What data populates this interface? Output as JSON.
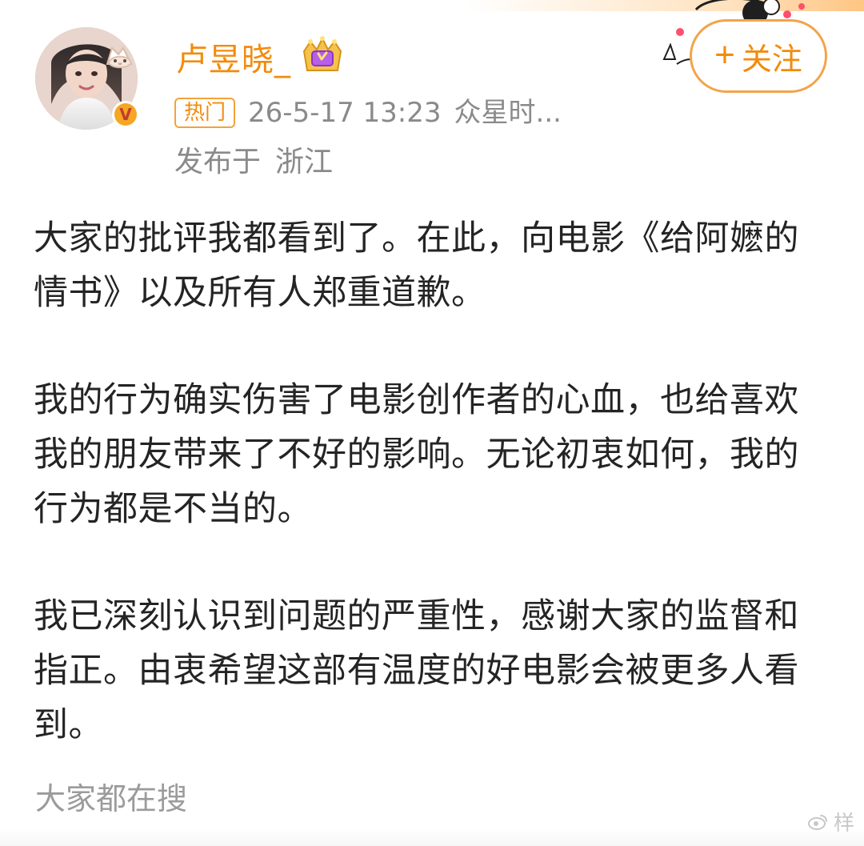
{
  "header": {
    "username": "卢昱晓_",
    "hot_badge": "热门",
    "post_time": "26-5-17 13:23",
    "post_source": "众星时...",
    "location_label": "发布于",
    "location_value": "浙江",
    "follow_label": "关注",
    "follow_icon": "plus-icon",
    "verify_icon": "verified-badge-icon",
    "crown_icon": "crown-badge-icon",
    "colors": {
      "accent": "#f28b0c",
      "meta_gray": "#8a8a8a"
    }
  },
  "post": {
    "paragraphs": [
      "大家的批评我都看到了。在此，向电影《给阿嬷的情书》以及所有人郑重道歉。",
      "我的行为确实伤害了电影创作者的心血，也给喜欢我的朋友带来了不好的影响。无论初衷如何，我的行为都是不当的。",
      "我已深刻认识到问题的严重性，感谢大家的监督和指正。由衷希望这部有温度的好电影会被更多人看到。"
    ]
  },
  "footer": {
    "search_label": "大家都在搜",
    "watermark_text": "样",
    "watermark_icon": "weibo-icon"
  }
}
